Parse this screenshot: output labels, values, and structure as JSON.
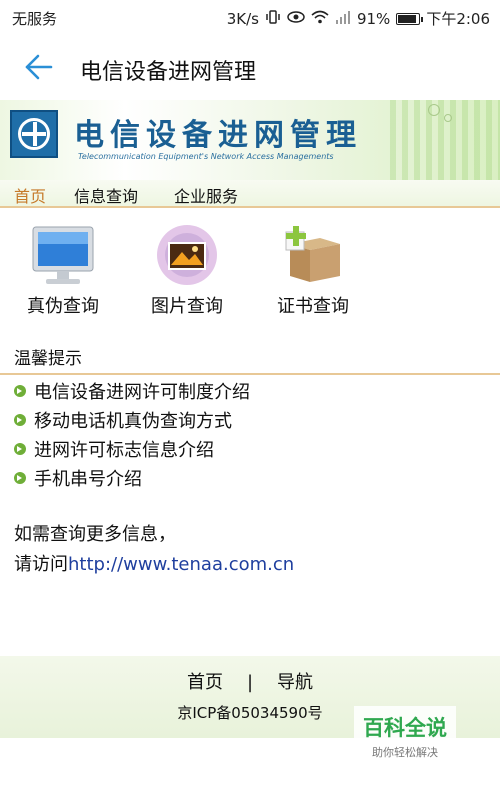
{
  "status_bar": {
    "carrier": "无服务",
    "speed": "3K/s",
    "battery": "91%",
    "time": "下午2:06"
  },
  "title_bar": {
    "title": "电信设备进网管理"
  },
  "banner": {
    "cn": "电信设备进网管理",
    "en": "Telecommunication Equipment's Network Access Managements"
  },
  "nav": {
    "tabs": [
      "首页",
      "信息查询",
      "企业服务"
    ]
  },
  "services": [
    {
      "label": "真伪查询",
      "icon": "monitor-icon"
    },
    {
      "label": "图片查询",
      "icon": "picture-icon"
    },
    {
      "label": "证书查询",
      "icon": "certificate-box-icon"
    }
  ],
  "tips": {
    "title": "温馨提示",
    "items": [
      "电信设备进网许可制度介绍",
      "移动电话机真伪查询方式",
      "进网许可标志信息介绍",
      "手机串号介绍"
    ]
  },
  "more_info": {
    "line1": "如需查询更多信息，",
    "line2_prefix": "请访问",
    "link": "http://www.tenaa.com.cn"
  },
  "footer": {
    "home": "首页",
    "sep": "|",
    "nav": "导航",
    "icp": "京ICP备05034590号"
  },
  "watermark": {
    "title": "百科全说",
    "subtitle": "助你轻松解决"
  },
  "colors": {
    "accent_orange": "#c67a2a",
    "link_blue": "#1f3f9e",
    "back_blue": "#2a8fd6"
  }
}
